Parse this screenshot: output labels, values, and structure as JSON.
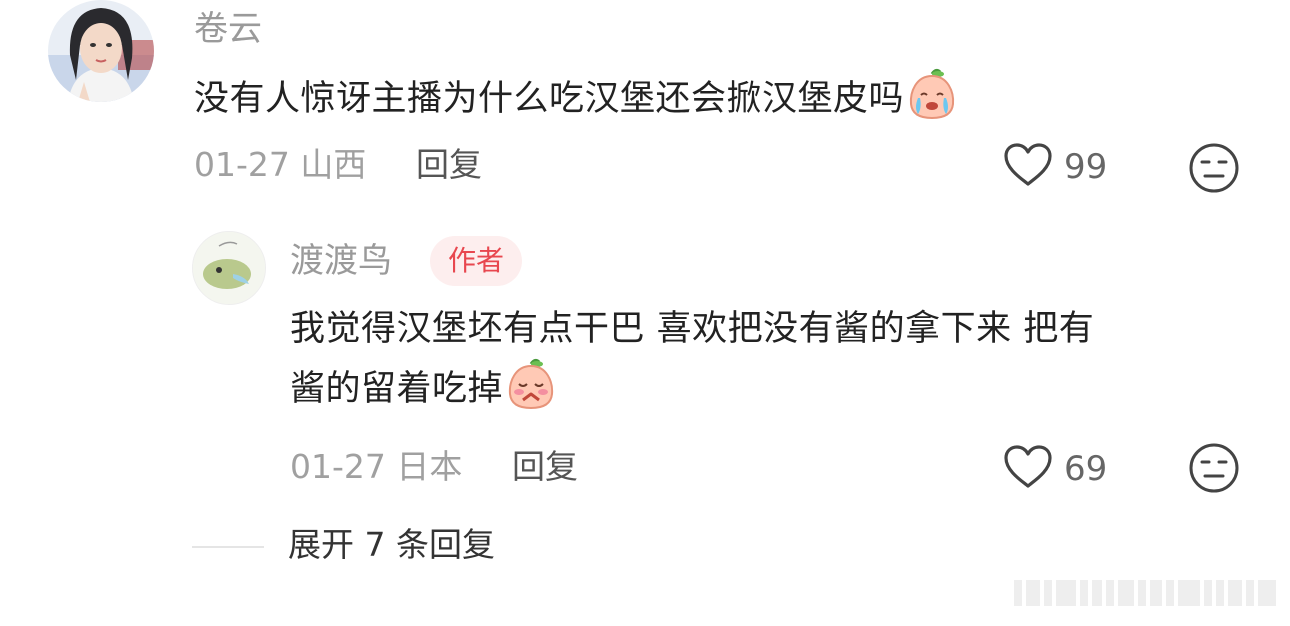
{
  "comment": {
    "username": "卷云",
    "text": "没有人惊讶主播为什么吃汉堡还会掀汉堡皮吗",
    "emoji_icon": "crying-peach-emoji-icon",
    "date": "01-27",
    "location": "山西",
    "reply_label": "回复",
    "likes": "99"
  },
  "reply": {
    "username": "渡渡鸟",
    "author_badge": "作者",
    "text_line1": "我觉得汉堡坯有点干巴 喜欢把没有酱的拿下来 把有",
    "text_line2": "酱的留着吃掉",
    "emoji_icon": "pleading-peach-emoji-icon",
    "date": "01-27",
    "location": "日本",
    "reply_label": "回复",
    "likes": "69"
  },
  "expand_label": "展开 7 条回复",
  "colors": {
    "author_badge_bg": "#fdeeee",
    "author_badge_text": "#e8474f",
    "muted_text": "#a0a0a0",
    "main_text": "#222222"
  }
}
